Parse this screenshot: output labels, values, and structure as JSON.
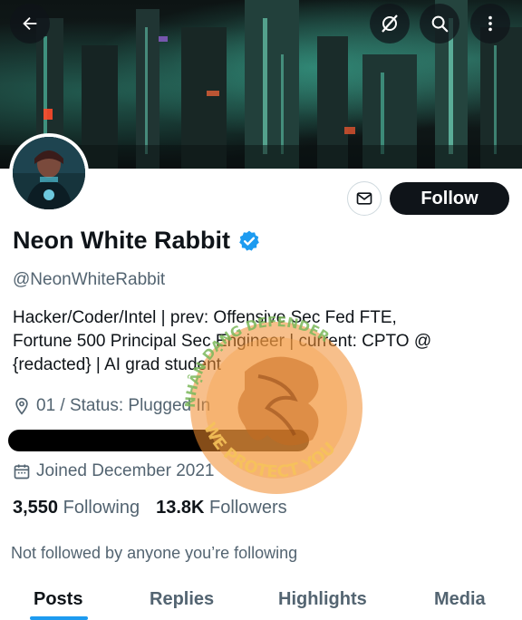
{
  "header": {
    "back_icon": "arrow-left-icon",
    "grok_icon": "grok-slash-icon",
    "search_icon": "search-icon",
    "more_icon": "more-vertical-icon"
  },
  "profile": {
    "display_name": "Neon White Rabbit",
    "verified_icon": "verified-badge-icon",
    "verified_color": "#1d9bf0",
    "handle": "@NeonWhiteRabbit",
    "bio_line1": "Hacker/Coder/Intel | prev: Offensive Sec Fed FTE,",
    "bio_line2": "Fortune 500 Principal Sec Engineer | current: CPTO @",
    "bio_line3": "{redacted} | AI grad student",
    "location": "01 / Status: Plugged In",
    "joined": "Joined December 2021"
  },
  "actions": {
    "message_icon": "envelope-icon",
    "follow_label": "Follow"
  },
  "stats": {
    "following_count": "3,550",
    "following_label": "Following",
    "followers_count": "13.8K",
    "followers_label": "Followers"
  },
  "social_context": "Not followed by anyone you’re following",
  "tabs": [
    {
      "label": "Posts",
      "active": true
    },
    {
      "label": "Replies",
      "active": false
    },
    {
      "label": "Highlights",
      "active": false
    },
    {
      "label": "Media",
      "active": false
    }
  ],
  "watermark": {
    "text_top": "NHẬN DẠNG DEFENDER",
    "text_bottom": "WE PROTECT YOU"
  },
  "colors": {
    "accent": "#1d9bf0",
    "follow_bg": "#0f1419",
    "secondary_text": "#536471"
  }
}
